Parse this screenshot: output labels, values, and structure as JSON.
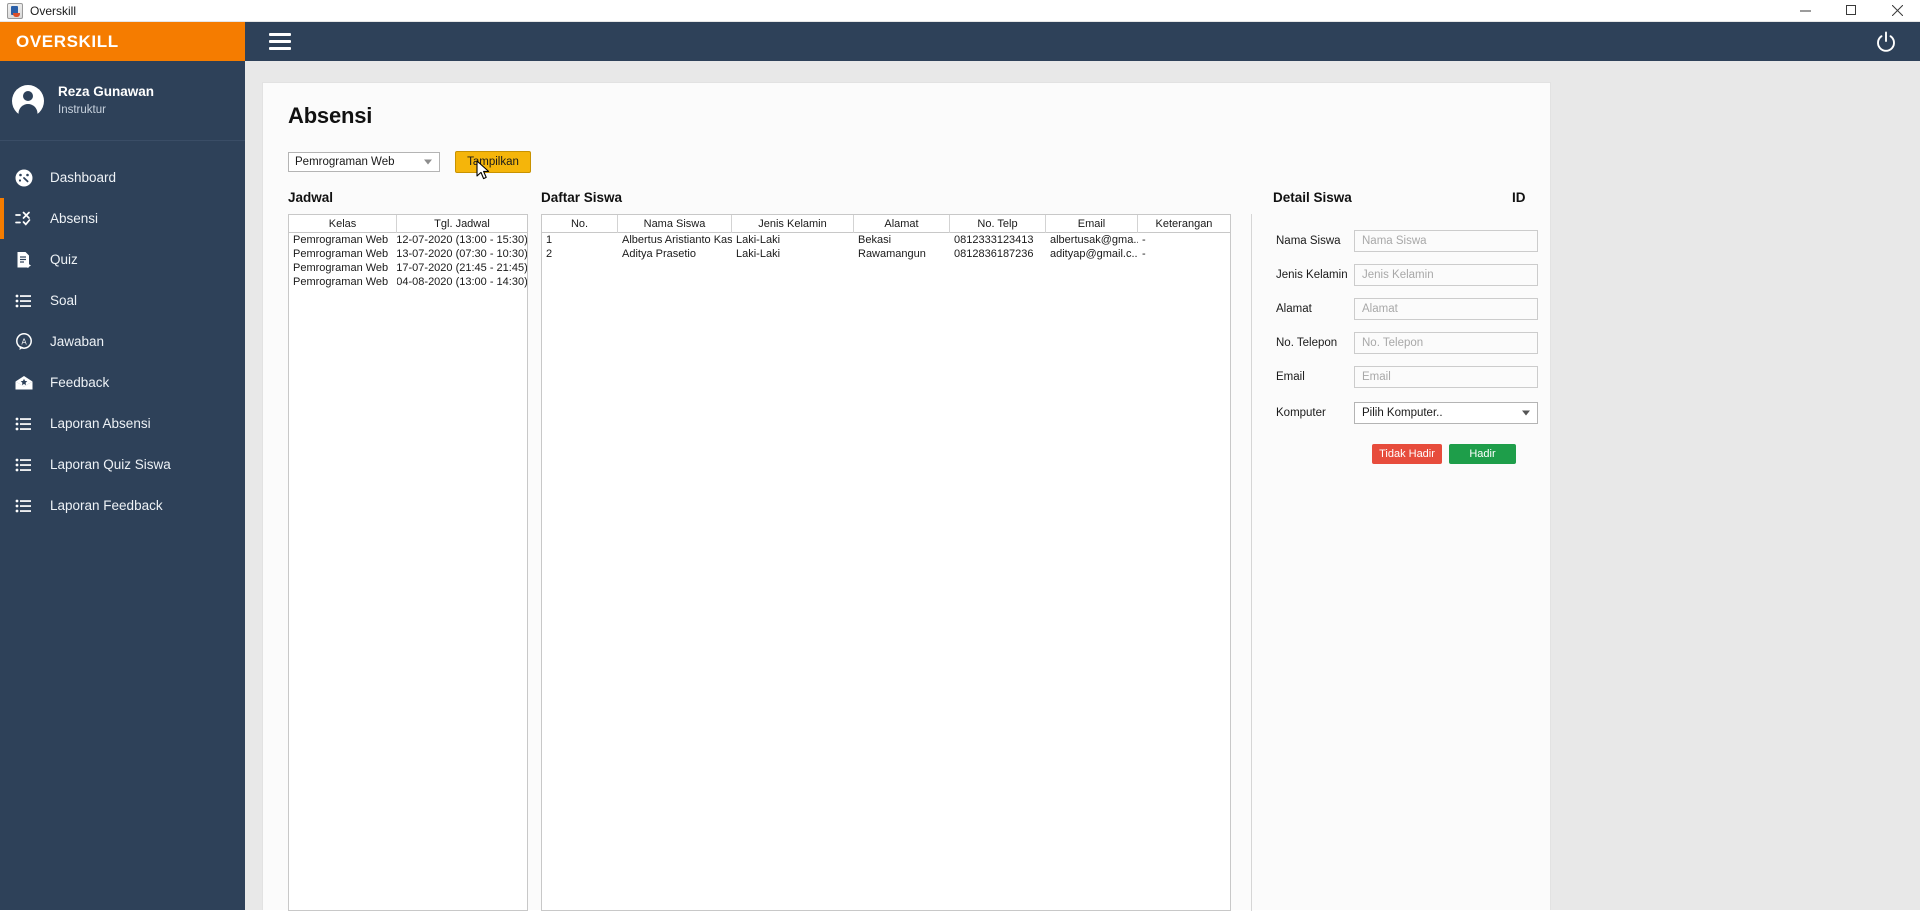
{
  "window": {
    "title": "Overskill",
    "app_icon": "java-app-icon",
    "controls": {
      "minimize": "minimize-icon",
      "maximize": "maximize-icon",
      "close": "close-icon"
    }
  },
  "brand": {
    "name": "OVERSKILL",
    "color": "#f57c00"
  },
  "topbar": {
    "menu_icon": "hamburger-icon",
    "power_icon": "power-icon"
  },
  "profile": {
    "name": "Reza Gunawan",
    "role": "Instruktur",
    "avatar_icon": "user-avatar-icon"
  },
  "sidebar": {
    "background": "#2e4159",
    "active_indicator_color": "#f57c00",
    "items": [
      {
        "label": "Dashboard",
        "icon": "dashboard-gauge-icon",
        "active": false
      },
      {
        "label": "Absensi",
        "icon": "attendance-check-icon",
        "active": true
      },
      {
        "label": "Quiz",
        "icon": "quiz-document-icon",
        "active": false
      },
      {
        "label": "Soal",
        "icon": "list-icon",
        "active": false
      },
      {
        "label": "Jawaban",
        "icon": "answer-bubble-icon",
        "active": false
      },
      {
        "label": "Feedback",
        "icon": "envelope-star-icon",
        "active": false
      },
      {
        "label": "Laporan Absensi",
        "icon": "list-icon",
        "active": false
      },
      {
        "label": "Laporan Quiz Siswa",
        "icon": "list-icon",
        "active": false
      },
      {
        "label": "Laporan Feedback",
        "icon": "list-icon",
        "active": false
      }
    ]
  },
  "main": {
    "page_title": "Absensi",
    "filter": {
      "selected_class": "Pemrograman Web",
      "dropdown_icon": "chevron-down-icon",
      "show_button": "Tampilkan",
      "show_button_color": "#f5b50a"
    },
    "jadwal": {
      "heading": "Jadwal",
      "columns": [
        "Kelas",
        "Tgl. Jadwal"
      ],
      "rows": [
        [
          "Pemrograman Web",
          "12-07-2020 (13:00 - 15:30)"
        ],
        [
          "Pemrograman Web",
          "13-07-2020 (07:30 - 10:30)"
        ],
        [
          "Pemrograman Web",
          "17-07-2020 (21:45 - 21:45)"
        ],
        [
          "Pemrograman Web",
          "04-08-2020 (13:00 - 14:30)"
        ]
      ]
    },
    "daftar_siswa": {
      "heading": "Daftar Siswa",
      "columns": [
        "No.",
        "Nama Siswa",
        "Jenis Kelamin",
        "Alamat",
        "No. Telp",
        "Email",
        "Keterangan"
      ],
      "rows": [
        [
          "1",
          "Albertus Aristianto Kas...",
          "Laki-Laki",
          "Bekasi",
          "0812333123413",
          "albertusak@gma...",
          "-"
        ],
        [
          "2",
          "Aditya Prasetio",
          "Laki-Laki",
          "Rawamangun",
          "0812836187236",
          "adityap@gmail.c...",
          "-"
        ]
      ]
    },
    "detail_siswa": {
      "heading": "Detail Siswa",
      "id_label": "ID",
      "fields": [
        {
          "label": "Nama Siswa",
          "placeholder": "Nama Siswa",
          "value": ""
        },
        {
          "label": "Jenis Kelamin",
          "placeholder": "Jenis Kelamin",
          "value": ""
        },
        {
          "label": "Alamat",
          "placeholder": "Alamat",
          "value": ""
        },
        {
          "label": "No. Telepon",
          "placeholder": "No. Telepon",
          "value": ""
        },
        {
          "label": "Email",
          "placeholder": "Email",
          "value": ""
        }
      ],
      "komputer": {
        "label": "Komputer",
        "selected": "Pilih Komputer..",
        "dropdown_icon": "chevron-down-icon"
      },
      "buttons": {
        "absent": "Tidak Hadir",
        "absent_color": "#e74c3c",
        "present": "Hadir",
        "present_color": "#1e9e4a"
      }
    }
  }
}
